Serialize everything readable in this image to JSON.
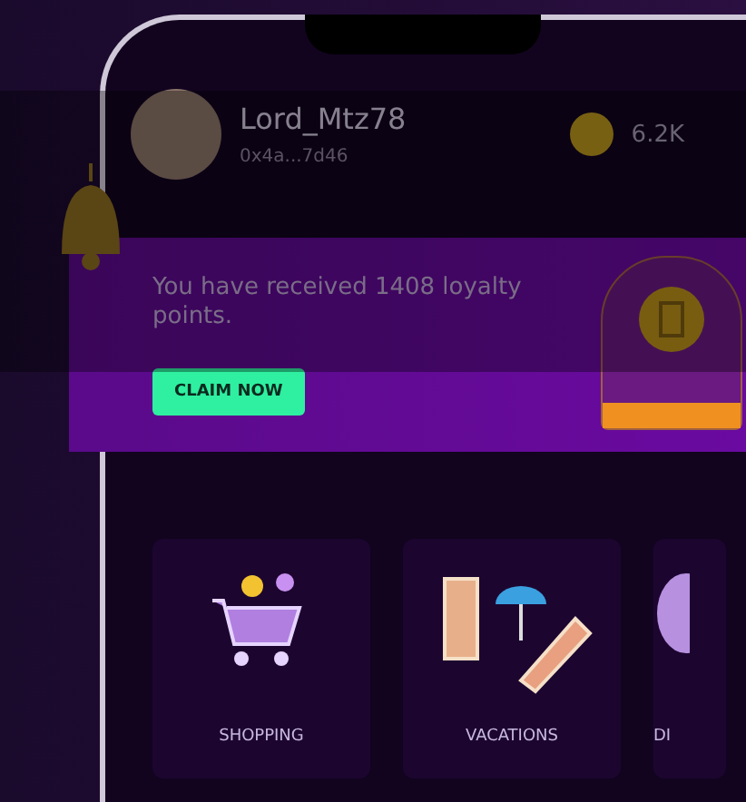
{
  "profile": {
    "username": "Lord_Mtz78",
    "wallet": "0x4a...7d46",
    "coins": "6.2K"
  },
  "banner": {
    "message": "You have received 1408 loyalty points.",
    "button": "CLAIM NOW"
  },
  "categories": [
    {
      "label": "SHOPPING",
      "kind": "cart"
    },
    {
      "label": "VACATIONS",
      "kind": "beach"
    },
    {
      "label": "DI",
      "kind": "other"
    }
  ]
}
